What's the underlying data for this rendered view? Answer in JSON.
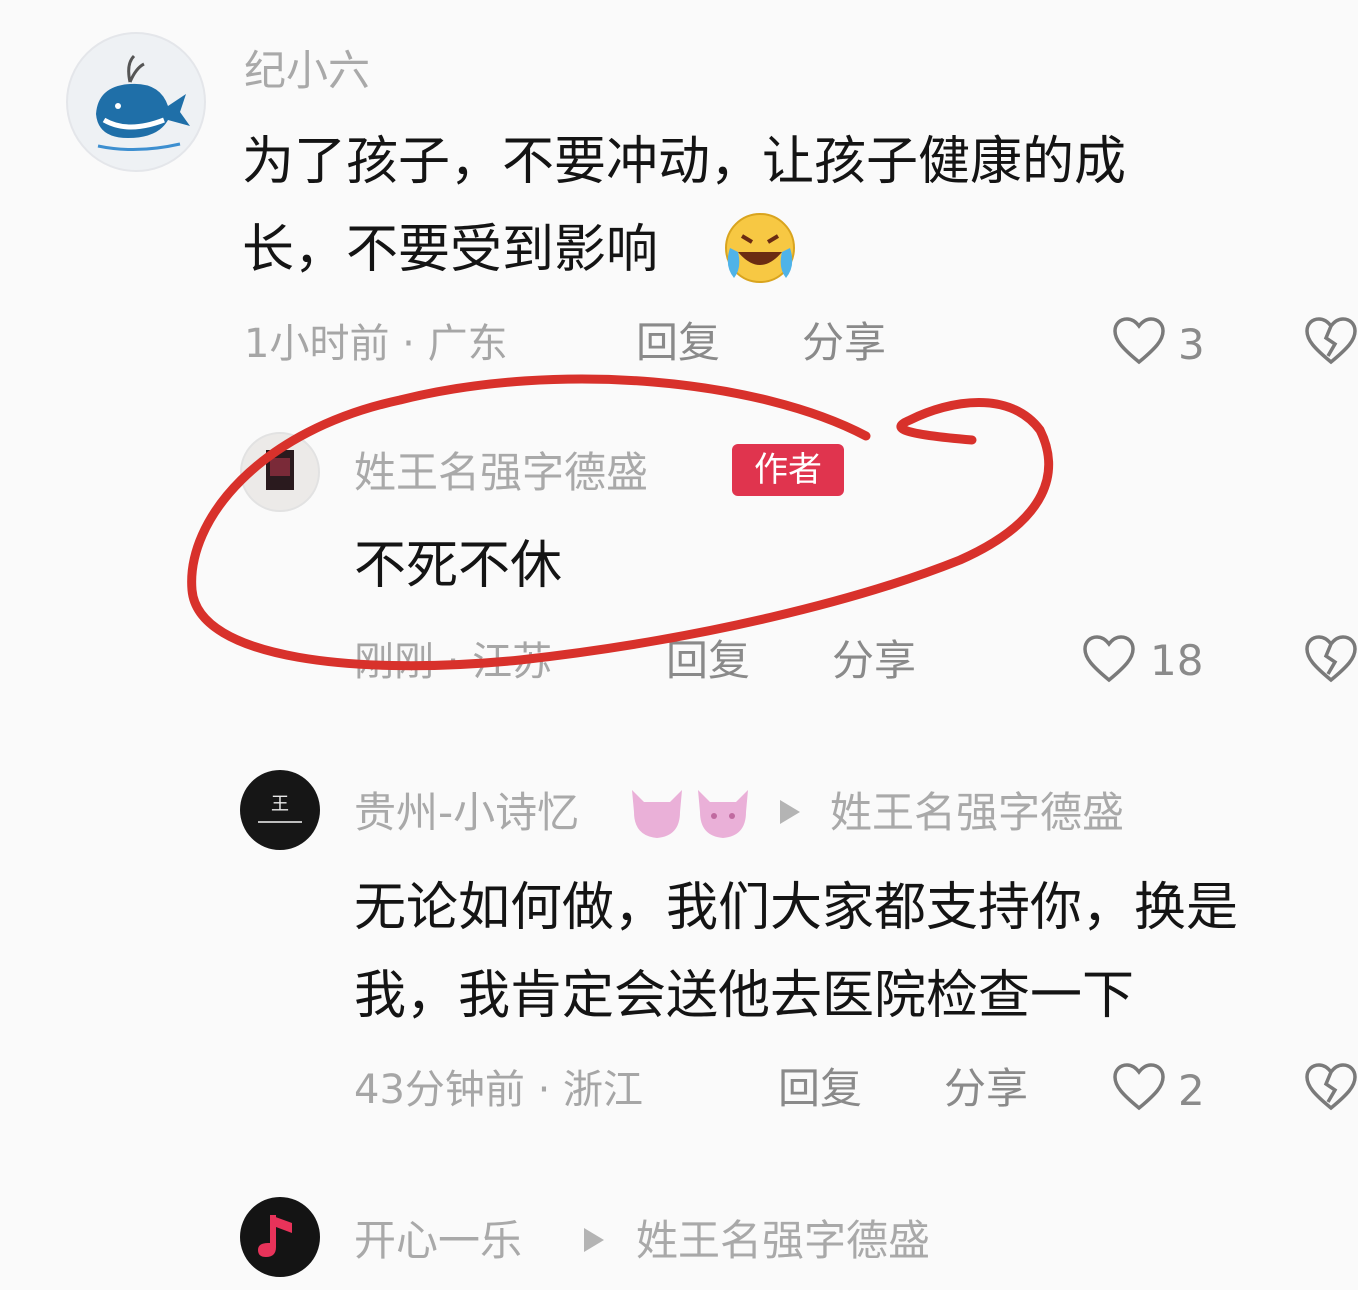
{
  "comments": [
    {
      "username": "纪小六",
      "text_line1": "为了孩子，不要冲动，让孩子健康的成",
      "text_line2": "长，不要受到影响",
      "meta": "1小时前 · 广东",
      "reply_label": "回复",
      "share_label": "分享",
      "likes": "3"
    }
  ],
  "reply_author": {
    "username": "姓王名强字德盛",
    "tag": "作者",
    "text": "不死不休",
    "meta": "刚刚 · 江苏",
    "reply_label": "回复",
    "share_label": "分享",
    "likes": "18"
  },
  "reply_guizhou": {
    "username": "贵州-小诗忆",
    "reply_to": "姓王名强字德盛",
    "text_line1": "无论如何做，我们大家都支持你，换是",
    "text_line2": "我，我肯定会送他去医院检查一下",
    "meta": "43分钟前 · 浙江",
    "reply_label": "回复",
    "share_label": "分享",
    "likes": "2"
  },
  "reply_kaixin": {
    "username": "开心一乐",
    "reply_to": "姓王名强字德盛"
  },
  "colors": {
    "circle": "#d8312b",
    "author_tag": "#e0344e",
    "secondary_text": "#a9a9a9"
  },
  "icons": [
    "whale-avatar",
    "laughing-crying-emoji",
    "heart-icon",
    "broken-heart-icon",
    "devil-emoji",
    "triangle-arrow-icon",
    "music-note-avatar"
  ]
}
